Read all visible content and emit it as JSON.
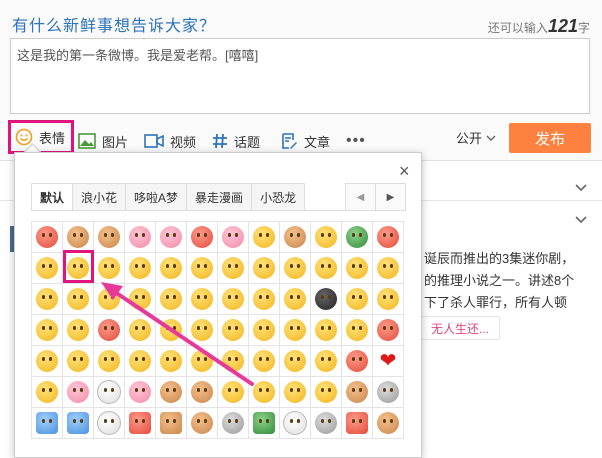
{
  "composer": {
    "prompt": "有什么新鲜事想告诉大家？",
    "remaining_prefix": "还可以输入",
    "remaining_count": "121",
    "remaining_suffix": "字",
    "text": "这是我的第一条微博。我是爱老帮。[嘻嘻]"
  },
  "toolbar": {
    "emoji_label": "表情",
    "image_label": "图片",
    "video_label": "视频",
    "topic_label": "话题",
    "article_label": "文章",
    "more_label": "•••",
    "visibility_label": "公开",
    "send_label": "发布"
  },
  "emoji_popup": {
    "close_label": "×",
    "tabs": [
      "默认",
      "浪小花",
      "哆啦A梦",
      "暴走漫画",
      "小恐龙"
    ],
    "active_tab": "默认",
    "prev_label": "◀",
    "next_label": "▶",
    "selected_index": 13
  },
  "feed": {
    "line1": "诞辰而推出的3集迷你剧，",
    "line2": "的推理小说之一。讲述8个",
    "line3": "下了杀人罪行，所有人顿",
    "tag": "无人生还..."
  },
  "colors": {
    "accent": "#e0147c",
    "send": "#ff8140",
    "link": "#2c73b8"
  }
}
